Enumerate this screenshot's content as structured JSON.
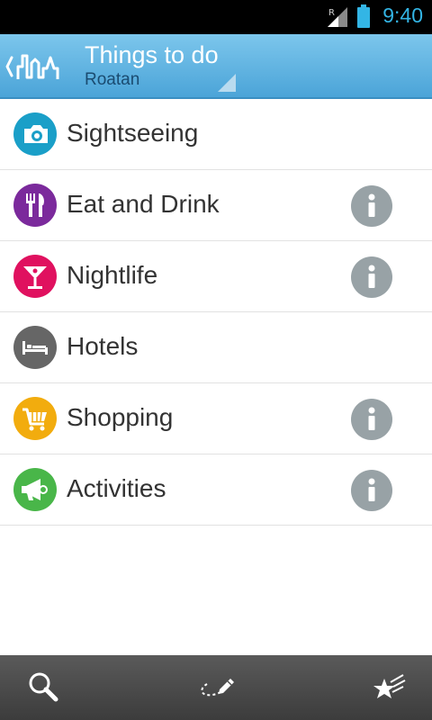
{
  "status_bar": {
    "time": "9:40",
    "roaming_indicator": "R",
    "signal_icon": "signal-icon",
    "battery_icon": "battery-icon",
    "accent_color": "#33b5e5"
  },
  "action_bar": {
    "home_icon": "city-skyline-icon",
    "title": "Things to do",
    "subtitle": "Roatan",
    "background_color": "#5fb2e0"
  },
  "categories": [
    {
      "label": "Sightseeing",
      "icon": "camera-icon",
      "color": "#1a9fc8",
      "has_info": false
    },
    {
      "label": "Eat and Drink",
      "icon": "fork-knife-icon",
      "color": "#7b2a9c",
      "has_info": true
    },
    {
      "label": "Nightlife",
      "icon": "cocktail-glass-icon",
      "color": "#e0115f",
      "has_info": true
    },
    {
      "label": "Hotels",
      "icon": "bed-icon",
      "color": "#666666",
      "has_info": false
    },
    {
      "label": "Shopping",
      "icon": "shopping-cart-icon",
      "color": "#f2ac0e",
      "has_info": true
    },
    {
      "label": "Activities",
      "icon": "megaphone-icon",
      "color": "#49b649",
      "has_info": true
    }
  ],
  "bottom_bar": {
    "search_icon": "search-icon",
    "route_icon": "route-pencil-icon",
    "favorites_icon": "shooting-star-icon"
  }
}
